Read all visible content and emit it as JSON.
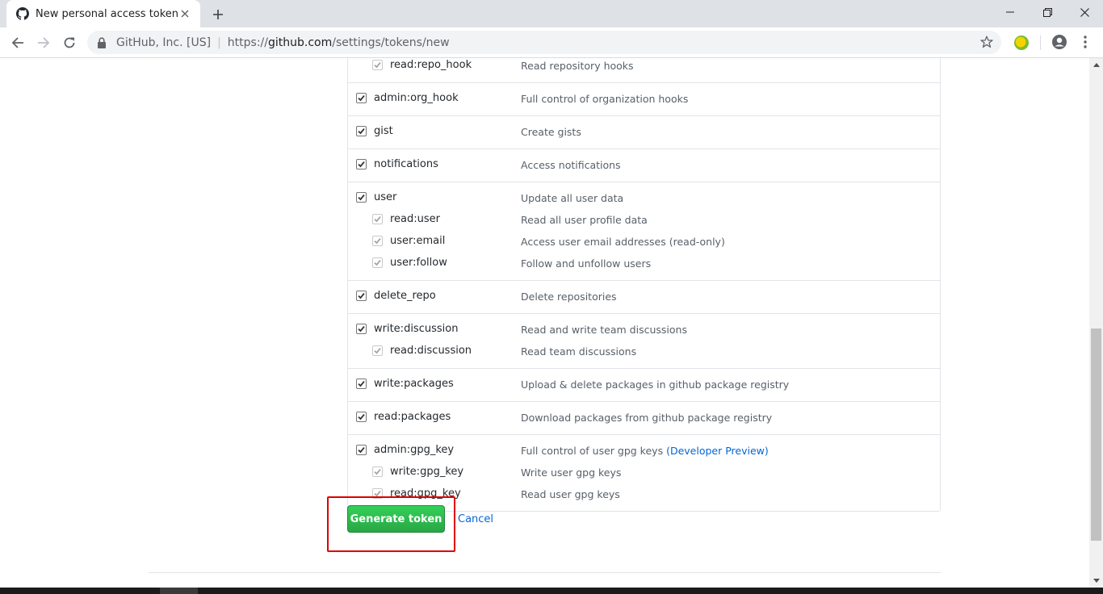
{
  "browser": {
    "tab_title": "New personal access token",
    "url_org": "GitHub, Inc. [US]",
    "url_scheme": "https://",
    "url_host": "github.com",
    "url_path": "/settings/tokens/new"
  },
  "scope_groups": [
    {
      "rows": [
        {
          "name": "read:repo_hook",
          "desc": "Read repository hooks",
          "sub": true
        }
      ]
    },
    {
      "rows": [
        {
          "name": "admin:org_hook",
          "desc": "Full control of organization hooks",
          "sub": false
        }
      ]
    },
    {
      "rows": [
        {
          "name": "gist",
          "desc": "Create gists",
          "sub": false
        }
      ]
    },
    {
      "rows": [
        {
          "name": "notifications",
          "desc": "Access notifications",
          "sub": false
        }
      ]
    },
    {
      "rows": [
        {
          "name": "user",
          "desc": "Update all user data",
          "sub": false
        },
        {
          "name": "read:user",
          "desc": "Read all user profile data",
          "sub": true
        },
        {
          "name": "user:email",
          "desc": "Access user email addresses (read-only)",
          "sub": true
        },
        {
          "name": "user:follow",
          "desc": "Follow and unfollow users",
          "sub": true
        }
      ]
    },
    {
      "rows": [
        {
          "name": "delete_repo",
          "desc": "Delete repositories",
          "sub": false
        }
      ]
    },
    {
      "rows": [
        {
          "name": "write:discussion",
          "desc": "Read and write team discussions",
          "sub": false
        },
        {
          "name": "read:discussion",
          "desc": "Read team discussions",
          "sub": true
        }
      ]
    },
    {
      "rows": [
        {
          "name": "write:packages",
          "desc": "Upload & delete packages in github package registry",
          "sub": false
        }
      ]
    },
    {
      "rows": [
        {
          "name": "read:packages",
          "desc": "Download packages from github package registry",
          "sub": false
        }
      ]
    },
    {
      "rows": [
        {
          "name": "admin:gpg_key",
          "desc": "Full control of user gpg keys",
          "link": "(Developer Preview)",
          "sub": false
        },
        {
          "name": "write:gpg_key",
          "desc": "Write user gpg keys",
          "sub": true
        },
        {
          "name": "read:gpg_key",
          "desc": "Read user gpg keys",
          "sub": true
        }
      ]
    }
  ],
  "actions": {
    "generate_label": "Generate token",
    "cancel_label": "Cancel"
  },
  "colors": {
    "accent_green": "#28a745",
    "link_blue": "#0366d6",
    "highlight_red": "#e00000"
  }
}
